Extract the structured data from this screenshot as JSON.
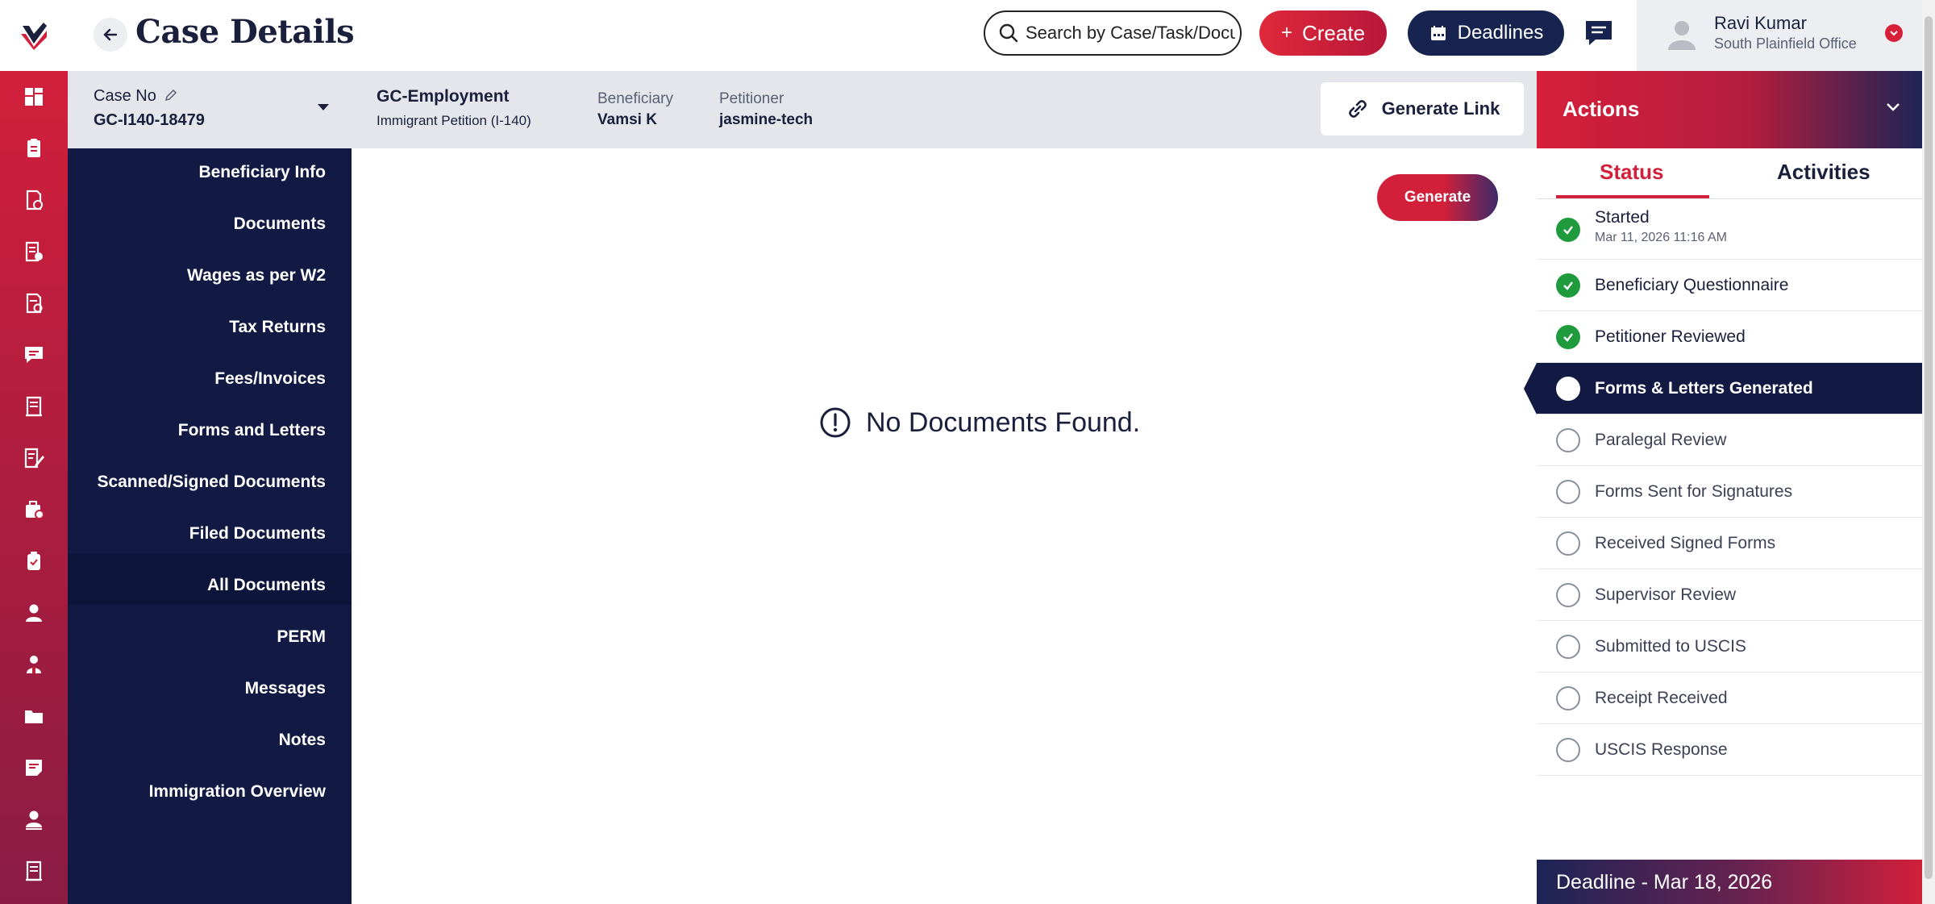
{
  "header": {
    "title": "Case Details",
    "search_placeholder": "Search by Case/Task/Document",
    "create_label": "Create",
    "deadlines_label": "Deadlines"
  },
  "user": {
    "name": "Ravi Kumar",
    "office": "South Plainfield Office"
  },
  "case": {
    "case_no_label": "Case No",
    "case_no": "GC-I140-18479",
    "type": "GC-Employment",
    "subtype": "Immigrant Petition (I-140)",
    "beneficiary_label": "Beneficiary",
    "beneficiary": "Vamsi K",
    "petitioner_label": "Petitioner",
    "petitioner": "jasmine-tech",
    "generate_link_label": "Generate Link"
  },
  "sidenav": {
    "items": [
      {
        "label": "Beneficiary Info"
      },
      {
        "label": "Documents"
      },
      {
        "label": "Wages as per W2"
      },
      {
        "label": "Tax Returns"
      },
      {
        "label": "Fees/Invoices"
      },
      {
        "label": "Forms and Letters"
      },
      {
        "label": "Scanned/Signed Documents"
      },
      {
        "label": "Filed Documents"
      },
      {
        "label": "All Documents"
      },
      {
        "label": "PERM"
      },
      {
        "label": "Messages"
      },
      {
        "label": "Notes"
      },
      {
        "label": "Immigration Overview"
      }
    ],
    "active": "Forms and Letters"
  },
  "main": {
    "generate_label": "Generate",
    "empty_message": "No Documents Found."
  },
  "actions": {
    "title": "Actions",
    "tabs": [
      {
        "label": "Status"
      },
      {
        "label": "Activities"
      }
    ],
    "active_tab": "Status",
    "steps": [
      {
        "label": "Started",
        "timestamp": "Mar 11, 2026 11:16 AM",
        "state": "done"
      },
      {
        "label": "Beneficiary Questionnaire",
        "state": "done"
      },
      {
        "label": "Petitioner Reviewed",
        "state": "done"
      },
      {
        "label": "Forms & Letters Generated",
        "state": "active"
      },
      {
        "label": "Paralegal Review",
        "state": "pending"
      },
      {
        "label": "Forms Sent for Signatures",
        "state": "pending"
      },
      {
        "label": "Received Signed Forms",
        "state": "pending"
      },
      {
        "label": "Supervisor Review",
        "state": "pending"
      },
      {
        "label": "Submitted to USCIS",
        "state": "pending"
      },
      {
        "label": "Receipt Received",
        "state": "pending"
      },
      {
        "label": "USCIS Response",
        "state": "pending"
      }
    ],
    "deadline": "Deadline - Mar 18, 2026"
  },
  "rail_icons": [
    "dashboard-icon",
    "clipboard-icon",
    "document-check-icon",
    "document-list-icon",
    "document-edit-icon",
    "chat-icon",
    "receipt-icon",
    "form-edit-icon",
    "briefcase-icon",
    "clipboard-check-icon",
    "user-icon",
    "user-group-icon",
    "folder-icon",
    "note-icon",
    "user-badge-icon",
    "ledger-icon"
  ],
  "colors": {
    "brand_red": "#d21f3a",
    "navy": "#121a44",
    "success_green": "#1f9b3e"
  }
}
